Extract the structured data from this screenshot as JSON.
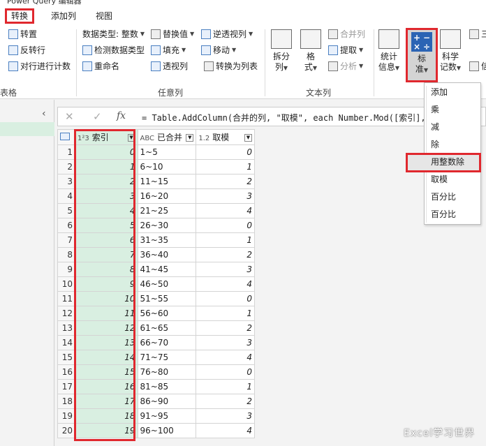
{
  "window": {
    "title": "Power Query 编辑器"
  },
  "tabs": [
    {
      "label": "转换",
      "active": true
    },
    {
      "label": "添加列",
      "active": false
    },
    {
      "label": "视图",
      "active": false
    }
  ],
  "ribbon": {
    "table_group": {
      "items": [
        "转置",
        "反转行",
        "对行进行计数"
      ],
      "label_partial": "表格"
    },
    "any_column_group": {
      "data_type": "数据类型: 整数",
      "detect_type": "检测数据类型",
      "rename": "重命名",
      "replace_values": "替换值",
      "fill": "填充",
      "pivot": "透视列",
      "unpivot": "逆透视列",
      "move": "移动",
      "to_list": "转换为列表",
      "label": "任意列"
    },
    "text_group": {
      "split": [
        "拆分",
        "列"
      ],
      "format": [
        "格",
        "式"
      ],
      "merge": "合并列",
      "extract": "提取",
      "parse": "分析",
      "label": "文本列"
    },
    "number_group": {
      "statistics": [
        "统计",
        "信息"
      ],
      "standard": [
        "标",
        "准"
      ],
      "scientific": [
        "科学",
        "记数"
      ],
      "trig_partial": "三",
      "info_partial": "信"
    }
  },
  "formula_bar": {
    "cancel": "✕",
    "confirm": "✓",
    "fx": "fx",
    "text": "= Table.AddColumn(合并的列, \"取模\", each Number.Mod([索引],"
  },
  "table": {
    "headers": [
      {
        "type": "1²3",
        "name": "索引"
      },
      {
        "type": "ABC",
        "name": "已合并"
      },
      {
        "type": "1.2",
        "name": "取模"
      }
    ],
    "rows": [
      [
        "1",
        "0",
        "1~5",
        "0"
      ],
      [
        "2",
        "1",
        "6~10",
        "1"
      ],
      [
        "3",
        "2",
        "11~15",
        "2"
      ],
      [
        "4",
        "3",
        "16~20",
        "3"
      ],
      [
        "5",
        "4",
        "21~25",
        "4"
      ],
      [
        "6",
        "5",
        "26~30",
        "0"
      ],
      [
        "7",
        "6",
        "31~35",
        "1"
      ],
      [
        "8",
        "7",
        "36~40",
        "2"
      ],
      [
        "9",
        "8",
        "41~45",
        "3"
      ],
      [
        "10",
        "9",
        "46~50",
        "4"
      ],
      [
        "11",
        "10",
        "51~55",
        "0"
      ],
      [
        "12",
        "11",
        "56~60",
        "1"
      ],
      [
        "13",
        "12",
        "61~65",
        "2"
      ],
      [
        "14",
        "13",
        "66~70",
        "3"
      ],
      [
        "15",
        "14",
        "71~75",
        "4"
      ],
      [
        "16",
        "15",
        "76~80",
        "0"
      ],
      [
        "17",
        "16",
        "81~85",
        "1"
      ],
      [
        "18",
        "17",
        "86~90",
        "2"
      ],
      [
        "19",
        "18",
        "91~95",
        "3"
      ],
      [
        "20",
        "19",
        "96~100",
        "4"
      ]
    ]
  },
  "dropdown_menu": {
    "items": [
      "添加",
      "乘",
      "减",
      "除",
      "用整数除",
      "取模",
      "百分比",
      "百分比"
    ],
    "highlighted_index": 4
  },
  "watermark": "Excel学习世界",
  "colors": {
    "accent_red": "#e0282e",
    "selected_column": "#d9efe1",
    "icon_blue": "#2b64b4"
  }
}
